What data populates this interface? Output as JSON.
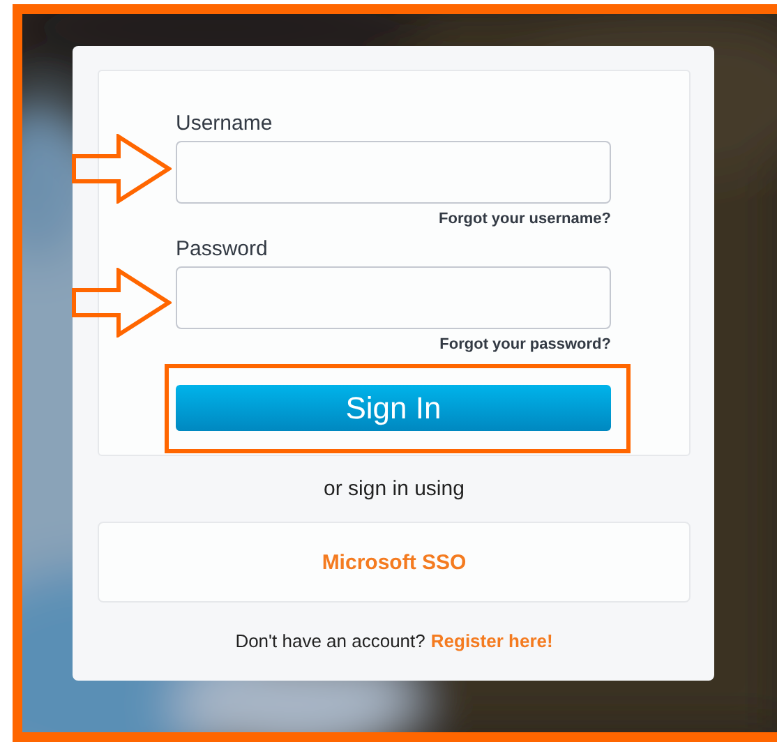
{
  "username": {
    "label": "Username",
    "link": "Forgot your username?"
  },
  "password": {
    "label": "Password",
    "link": "Forgot your password?"
  },
  "sign_in_button": "Sign In",
  "alternative": "or sign in using",
  "sso_button": "Microsoft SSO",
  "register": {
    "prompt": "Don't have an account?",
    "link": "Register here!"
  }
}
